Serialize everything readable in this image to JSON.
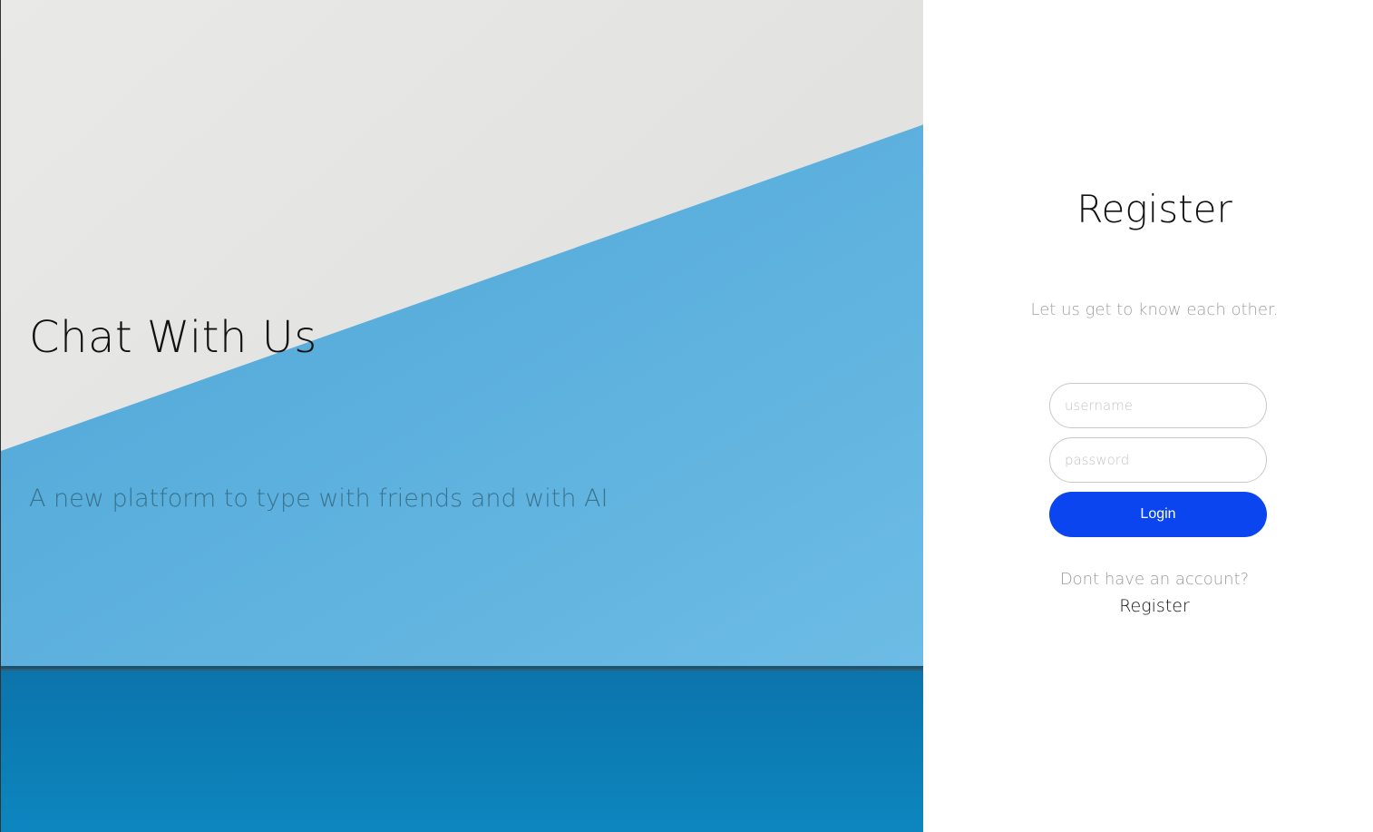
{
  "hero": {
    "title": "Chat With Us",
    "subtitle": "A new platform to type with friends and with AI"
  },
  "form": {
    "title": "Register",
    "tagline": "Let us get to know each other.",
    "username_placeholder": "username",
    "password_placeholder": "password",
    "login_label": "Login",
    "account_prompt": "Dont have an account?",
    "register_link": "Register"
  },
  "colors": {
    "accent": "#0b45f0",
    "hero_light": "#e6e6e4",
    "hero_blue": "#5aaedb",
    "hero_dark_blue": "#0c7cb6"
  }
}
